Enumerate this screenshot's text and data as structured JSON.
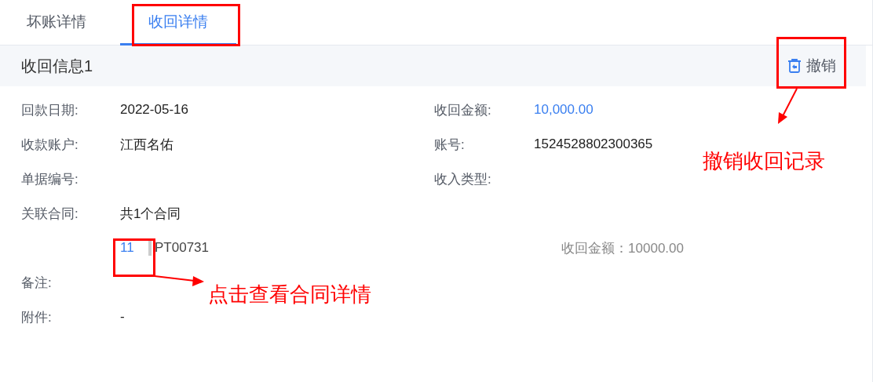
{
  "tabs": [
    {
      "label": "坏账详情",
      "selected": false
    },
    {
      "label": "收回详情",
      "selected": true
    }
  ],
  "section": {
    "title": "收回信息1",
    "revoke_button": "撤销"
  },
  "rows": [
    [
      {
        "label": "回款日期:",
        "value": "2022-05-16",
        "kind": "text"
      },
      {
        "label": "收回金额:",
        "value": "10,000.00",
        "kind": "amount"
      }
    ],
    [
      {
        "label": "收款账户:",
        "value": "江西名佑",
        "kind": "text"
      },
      {
        "label": "账号:",
        "value": "1524528802300365",
        "kind": "text"
      }
    ],
    [
      {
        "label": "单据编号:"
      },
      {
        "label": "收入类型:"
      }
    ],
    [
      {
        "label": "关联合同:",
        "value": "共1个合同",
        "kind": "text"
      }
    ]
  ],
  "contracts": [
    {
      "number": "11",
      "code": "PT00731",
      "amount_label": "收回金额：",
      "amount": "10000.00"
    }
  ],
  "extra_rows": [
    {
      "label": "备注:"
    },
    {
      "label": "附件:",
      "value": "-",
      "kind": "text"
    }
  ],
  "annotations": {
    "revoke_note": "撤销收回记录",
    "contract_note": "点击查看合同详情"
  }
}
